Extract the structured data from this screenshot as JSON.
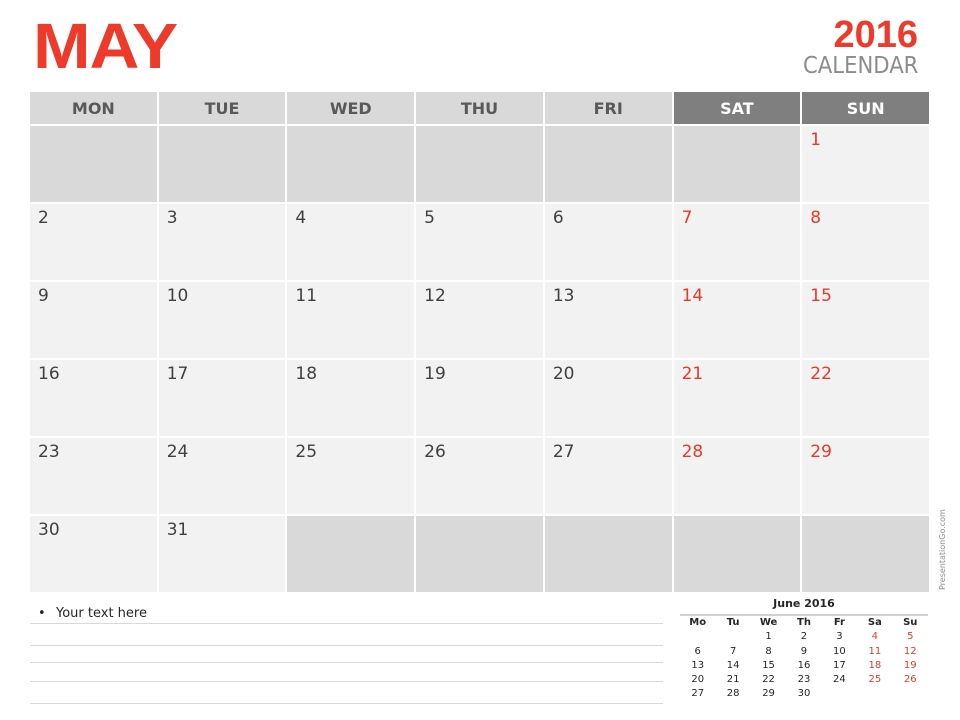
{
  "header": {
    "month": "MAY",
    "year": "2016",
    "label": "CALENDAR"
  },
  "colors": {
    "accent": "#ee3a2b",
    "weekend_text": "#e8392b",
    "header_fill": "#d9d9d9",
    "weekend_header_fill": "#7f7f7f",
    "day_cell_fill": "#f2f2f2",
    "empty_cell_fill": "#d9d9d9"
  },
  "calendar": {
    "weekdays": [
      {
        "label": "MON",
        "weekend": false
      },
      {
        "label": "TUE",
        "weekend": false
      },
      {
        "label": "WED",
        "weekend": false
      },
      {
        "label": "THU",
        "weekend": false
      },
      {
        "label": "FRI",
        "weekend": false
      },
      {
        "label": "SAT",
        "weekend": true
      },
      {
        "label": "SUN",
        "weekend": true
      }
    ],
    "weeks": [
      [
        "",
        "",
        "",
        "",
        "",
        "",
        "1"
      ],
      [
        "2",
        "3",
        "4",
        "5",
        "6",
        "7",
        "8"
      ],
      [
        "9",
        "10",
        "11",
        "12",
        "13",
        "14",
        "15"
      ],
      [
        "16",
        "17",
        "18",
        "19",
        "20",
        "21",
        "22"
      ],
      [
        "23",
        "24",
        "25",
        "26",
        "27",
        "28",
        "29"
      ],
      [
        "30",
        "31",
        "",
        "",
        "",
        "",
        ""
      ]
    ]
  },
  "notes": {
    "bullet": "•",
    "text": "Your text here",
    "line_count": 5
  },
  "mini_calendar": {
    "title": "June 2016",
    "weekdays": [
      "Mo",
      "Tu",
      "We",
      "Th",
      "Fr",
      "Sa",
      "Su"
    ],
    "weeks": [
      [
        "",
        "",
        "1",
        "2",
        "3",
        "4",
        "5"
      ],
      [
        "6",
        "7",
        "8",
        "9",
        "10",
        "11",
        "12"
      ],
      [
        "13",
        "14",
        "15",
        "16",
        "17",
        "18",
        "19"
      ],
      [
        "20",
        "21",
        "22",
        "23",
        "24",
        "25",
        "26"
      ],
      [
        "27",
        "28",
        "29",
        "30",
        "",
        "",
        ""
      ]
    ]
  },
  "watermark": "PresentationGo.com"
}
